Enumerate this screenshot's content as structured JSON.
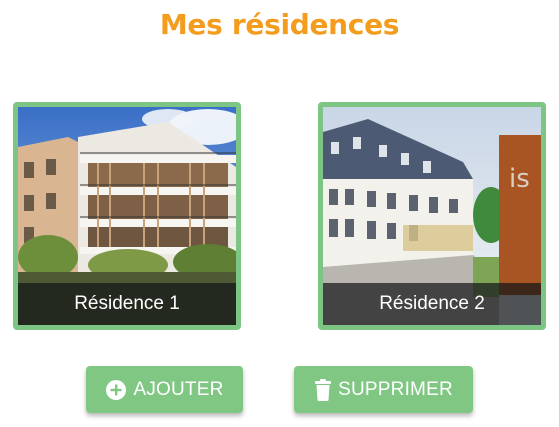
{
  "page": {
    "title": "Mes résidences"
  },
  "residences": [
    {
      "label": "Résidence 1"
    },
    {
      "label": "Résidence 2"
    }
  ],
  "actions": {
    "add_label": "AJOUTER",
    "delete_label": "SUPPRIMER",
    "add_icon": "plus-circle-icon",
    "delete_icon": "trash-icon"
  },
  "colors": {
    "title": "#f39c1e",
    "accent_green": "#7dc585",
    "button_green": "#80c784",
    "caption_bg": "#141618"
  }
}
